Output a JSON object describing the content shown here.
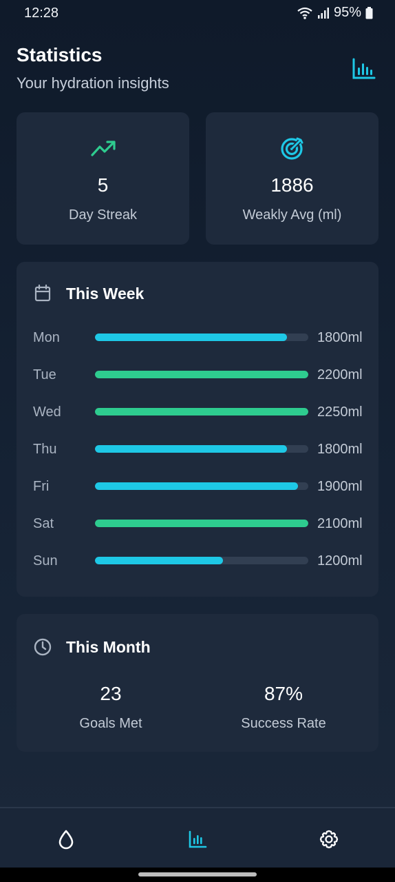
{
  "status_bar": {
    "time": "12:28",
    "battery": "95%"
  },
  "header": {
    "title": "Statistics",
    "subtitle": "Your hydration insights",
    "icon": "bar-chart-icon"
  },
  "stats": [
    {
      "icon": "trending-up-icon",
      "value": "5",
      "label": "Day Streak",
      "color": "#2ecc8f"
    },
    {
      "icon": "target-icon",
      "value": "1886",
      "label": "Weakly Avg (ml)",
      "color": "#1ec8e6"
    }
  ],
  "week": {
    "title": "This Week",
    "icon": "calendar-icon",
    "days": [
      {
        "day": "Mon",
        "amount": "1800ml",
        "progress": 0.9,
        "goal_met": false
      },
      {
        "day": "Tue",
        "amount": "2200ml",
        "progress": 1.0,
        "goal_met": true
      },
      {
        "day": "Wed",
        "amount": "2250ml",
        "progress": 1.0,
        "goal_met": true
      },
      {
        "day": "Thu",
        "amount": "1800ml",
        "progress": 0.9,
        "goal_met": false
      },
      {
        "day": "Fri",
        "amount": "1900ml",
        "progress": 0.95,
        "goal_met": false
      },
      {
        "day": "Sat",
        "amount": "2100ml",
        "progress": 1.0,
        "goal_met": true
      },
      {
        "day": "Sun",
        "amount": "1200ml",
        "progress": 0.6,
        "goal_met": false
      }
    ]
  },
  "month": {
    "title": "This Month",
    "icon": "clock-icon",
    "stats": [
      {
        "value": "23",
        "label": "Goals Met"
      },
      {
        "value": "87%",
        "label": "Success Rate"
      }
    ]
  },
  "nav": [
    {
      "name": "water-drop-icon",
      "active": false
    },
    {
      "name": "bar-chart-icon",
      "active": true
    },
    {
      "name": "settings-gear-icon",
      "active": false
    }
  ],
  "colors": {
    "accent_cyan": "#1ec8e6",
    "accent_green": "#2ecc8f",
    "card": "#1e2a3c",
    "inactive_icon": "#ffffff"
  }
}
